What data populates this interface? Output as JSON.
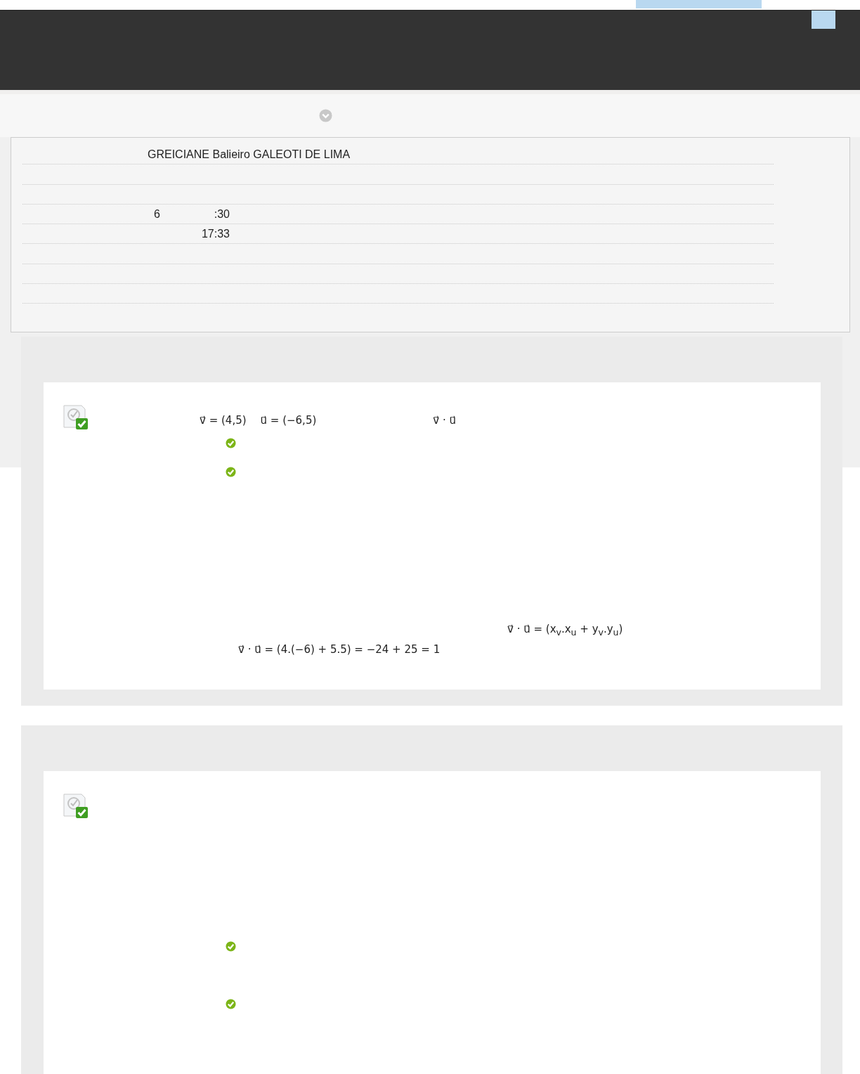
{
  "info_rows": [
    {
      "kind": "name",
      "text": "GREICIANE Balieiro GALEOTI DE LIMA"
    },
    {
      "kind": "blank"
    },
    {
      "kind": "blank"
    },
    {
      "kind": "time",
      "parts": [
        "6",
        ":30"
      ]
    },
    {
      "kind": "time",
      "parts": [
        "17:33"
      ]
    },
    {
      "kind": "blank"
    },
    {
      "kind": "blank"
    },
    {
      "kind": "blank"
    }
  ],
  "questions": [
    {
      "graded": true,
      "prompt": [
        "v⃗ = (4,5)",
        "u⃗ = (−6,5)",
        "v⃗ · u⃗"
      ],
      "answers": [
        {
          "correct": true
        },
        {
          "correct": true
        }
      ],
      "feedback": [
        "v⃗ · u⃗ = (x$_{v}$.x$_{u}$ + y$_{v}$.y$_{u}$)",
        "v⃗ · u⃗ = (4.(−6) + 5.5) = −24 + 25 = 1"
      ]
    },
    {
      "graded": true,
      "answers": [
        {
          "correct": true
        },
        {
          "correct": true
        }
      ]
    }
  ]
}
